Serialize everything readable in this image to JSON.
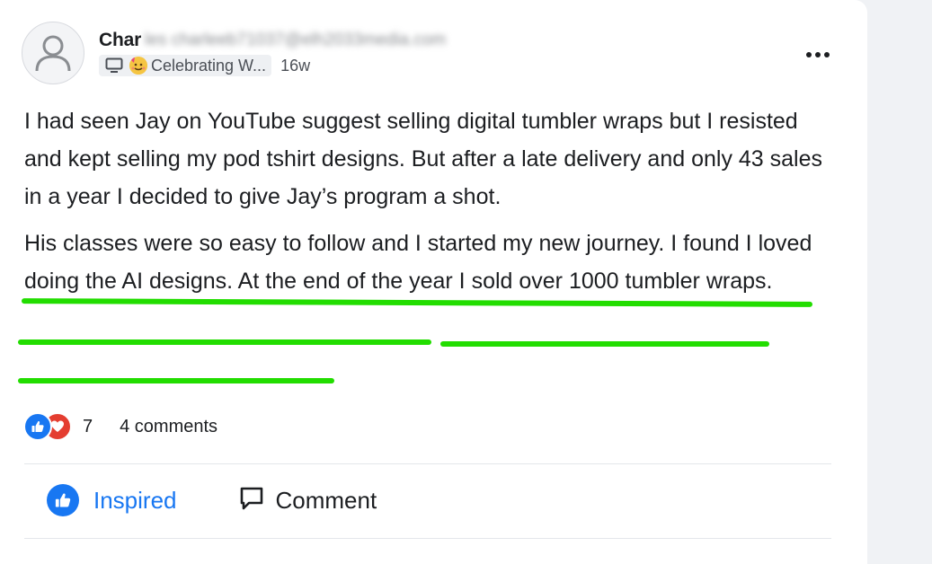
{
  "post": {
    "author": {
      "name": "Char",
      "email_blurred": "les charleeb71037@elh2033media.com"
    },
    "group": {
      "name": "Celebrating W...",
      "icon": "monitor-icon",
      "emoji_icon": "party-face-icon"
    },
    "timestamp": "16w",
    "more_icon": "ellipsis-icon",
    "paragraph_1": "I had seen Jay on YouTube suggest selling digital tumbler wraps but I resisted and kept selling my pod tshirt designs. But after a late delivery and only 43 sales in a year I decided to give Jay’s program a shot.",
    "paragraph_2": "His classes were so easy to follow and I started my new journey. I found I loved doing the AI designs. At the end of the year I sold over 1000 tumbler wraps.",
    "highlight_color": "#22dd00",
    "reactions": {
      "icons": [
        "like-icon",
        "heart-icon"
      ],
      "count": "7",
      "comments": "4 comments"
    },
    "actions": {
      "inspired": "Inspired",
      "comment": "Comment"
    },
    "colors": {
      "accent": "#1877f2",
      "heart": "#e43d30"
    }
  }
}
